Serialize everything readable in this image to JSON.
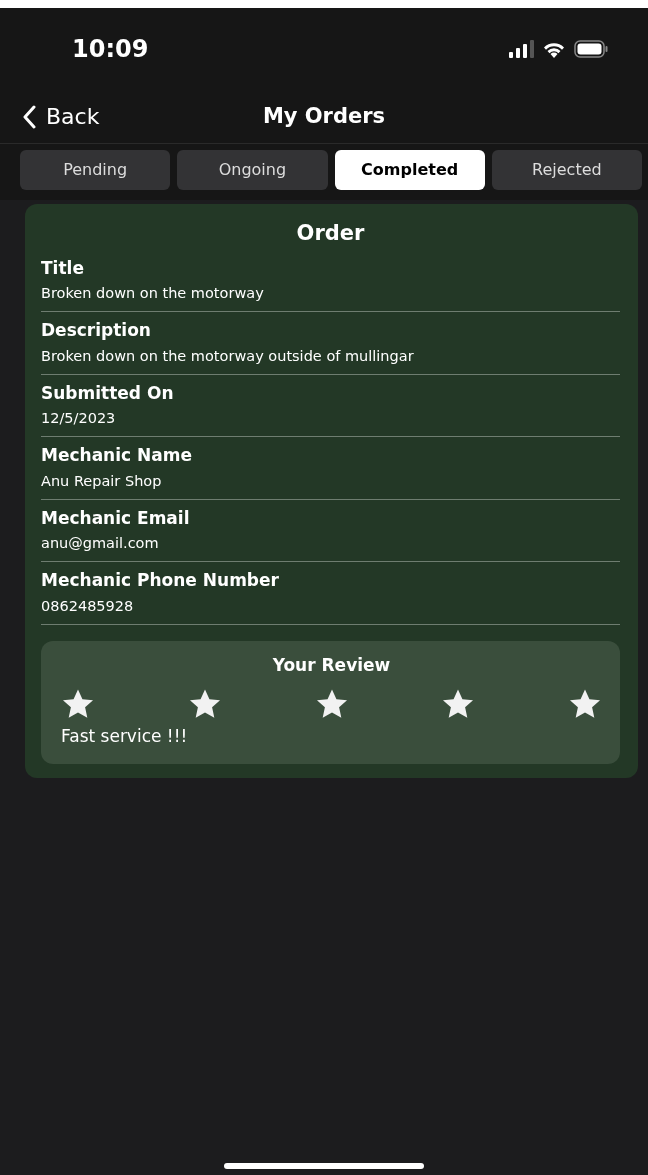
{
  "status_bar": {
    "time": "10:09"
  },
  "nav": {
    "back": "Back",
    "title": "My Orders"
  },
  "tabs": [
    {
      "label": "Pending",
      "selected": false
    },
    {
      "label": "Ongoing",
      "selected": false
    },
    {
      "label": "Completed",
      "selected": true
    },
    {
      "label": "Rejected",
      "selected": false
    }
  ],
  "order": {
    "heading": "Order",
    "fields": [
      {
        "label": "Title",
        "value": "Broken down on the motorway"
      },
      {
        "label": "Description",
        "value": "Broken down on the motorway outside of mullingar"
      },
      {
        "label": "Submitted On",
        "value": "12/5/2023"
      },
      {
        "label": "Mechanic Name",
        "value": "Anu Repair Shop"
      },
      {
        "label": "Mechanic Email",
        "value": "anu@gmail.com"
      },
      {
        "label": "Mechanic Phone Number",
        "value": "0862485928"
      }
    ],
    "review": {
      "heading": "Your Review",
      "stars": 5,
      "comment": "Fast service !!!"
    }
  }
}
